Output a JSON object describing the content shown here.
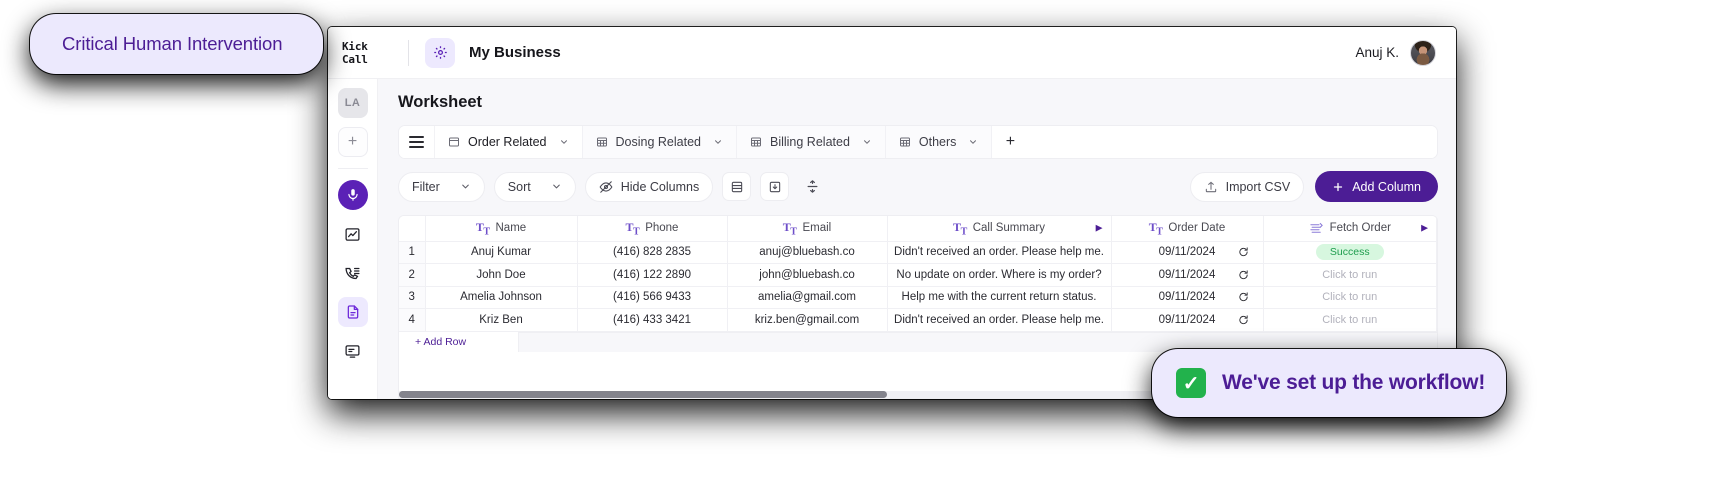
{
  "callouts": {
    "top": {
      "text": "Critical Human Intervention"
    },
    "bottom": {
      "text": "We've set up the workflow!",
      "icon": "check-mark-button-icon",
      "check_glyph": "✓"
    }
  },
  "topbar": {
    "brand_line1": "Kick",
    "brand_line2": "Call",
    "workspace_icon": "gear-icon",
    "workspace_name": "My Business",
    "user_name": "Anuj K.",
    "avatar": "user-avatar"
  },
  "rail": {
    "avatar_label": "LA",
    "add_label": "+",
    "items": [
      {
        "name": "microphone-icon",
        "active": true
      },
      {
        "name": "analytics-chart-icon",
        "active": false
      },
      {
        "name": "call-list-icon",
        "active": false
      },
      {
        "name": "document-icon",
        "active": true
      },
      {
        "name": "monitor-icon",
        "active": false
      }
    ]
  },
  "main": {
    "page_title": "Worksheet",
    "tabs": [
      {
        "label": "Order Related",
        "icon": "table-icon",
        "active": true
      },
      {
        "label": "Dosing Related",
        "icon": "table-icon",
        "active": false
      },
      {
        "label": "Billing Related",
        "icon": "table-icon",
        "active": false
      },
      {
        "label": "Others",
        "icon": "table-icon",
        "active": false
      }
    ],
    "tab_add_label": "+",
    "toolbar": {
      "filter_label": "Filter",
      "sort_label": "Sort",
      "hide_columns_label": "Hide Columns",
      "hide_columns_icon": "eye-off-icon",
      "row_height_icon": "row-height-icon",
      "download_icon": "download-icon",
      "sort_az_icon": "sort-icon",
      "import_csv_label": "Import CSV",
      "import_csv_icon": "upload-icon",
      "add_column_label": "Add Column",
      "add_column_icon": "plus-icon",
      "accent_color": "#4c1d95"
    }
  },
  "table": {
    "columns": [
      {
        "label": "Name",
        "icon": "text-type-icon",
        "caret": false
      },
      {
        "label": "Phone",
        "icon": "text-type-icon",
        "caret": false
      },
      {
        "label": "Email",
        "icon": "text-type-icon",
        "caret": false
      },
      {
        "label": "Call Summary",
        "icon": "text-type-icon",
        "caret": true
      },
      {
        "label": "Order Date",
        "icon": "text-type-icon",
        "caret": false
      },
      {
        "label": "Fetch Order",
        "icon": "workflow-icon",
        "caret": true
      }
    ],
    "rows": [
      {
        "num": "1",
        "name": "Anuj Kumar",
        "phone": "(416) 828 2835",
        "email": "anuj@bluebash.co",
        "summary": "Didn't received an order. Please help me.",
        "date": "09/11/2024",
        "fetch": "Success",
        "fetch_state": "success"
      },
      {
        "num": "2",
        "name": "John Doe",
        "phone": "(416) 122 2890",
        "email": "john@bluebash.co",
        "summary": "No update on order. Where is my order?",
        "date": "09/11/2024",
        "fetch": "Click to run",
        "fetch_state": "idle"
      },
      {
        "num": "3",
        "name": "Amelia Johnson",
        "phone": "(416) 566 9433",
        "email": "amelia@gmail.com",
        "summary": "Help me with the current return status.",
        "date": "09/11/2024",
        "fetch": "Click to run",
        "fetch_state": "idle"
      },
      {
        "num": "4",
        "name": "Kriz Ben",
        "phone": "(416) 433 3421",
        "email": "kriz.ben@gmail.com",
        "summary": "Didn't received an order. Please help me.",
        "date": "09/11/2024",
        "fetch": "Click to run",
        "fetch_state": "idle"
      }
    ],
    "add_row_label": "+ Add Row",
    "retry_icon": "refresh-icon",
    "success_color": "#1f9d4e",
    "success_bg": "#d7f7df"
  }
}
